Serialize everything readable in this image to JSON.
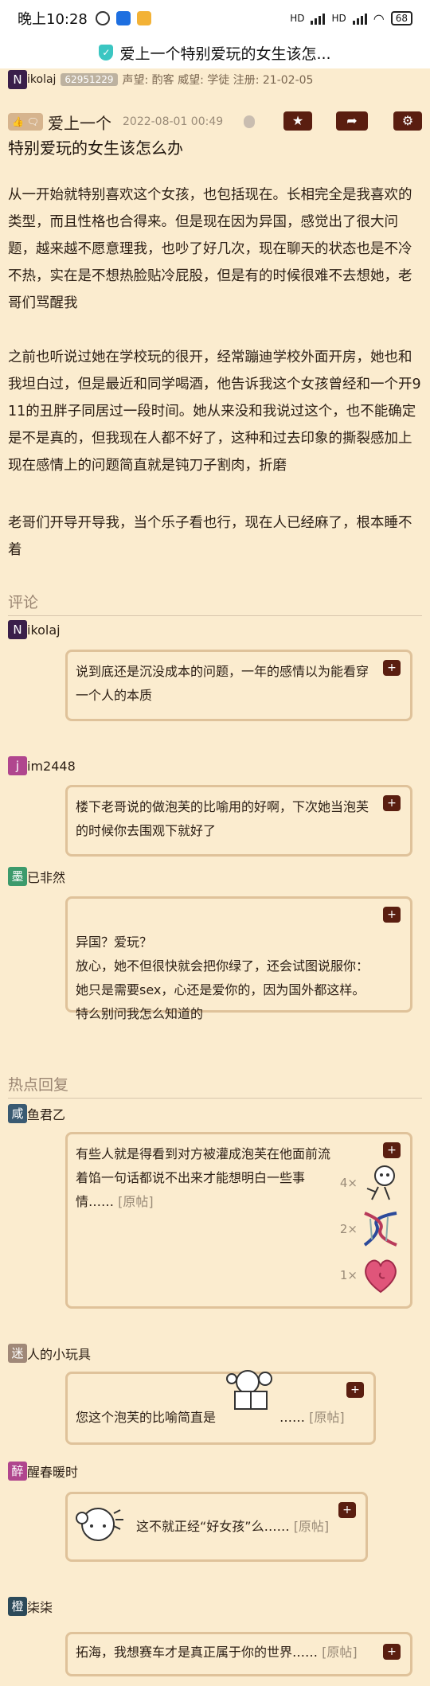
{
  "status": {
    "time": "晚上10:28",
    "signal": "HD",
    "battery": "68"
  },
  "title": "爱上一个特别爱玩的女生该怎...",
  "poster": {
    "avatar": "N",
    "name": "ikolaj",
    "uid": "62951229",
    "meta": "声望: 酌客 威望: 学徒 注册: 21-02-05"
  },
  "post": {
    "like_label": "👍 🗨",
    "title_line1": "爱上一个",
    "date": "2022-08-01 00:49",
    "title_line2": "特别爱玩的女生该怎么办",
    "paragraphs": [
      "从一开始就特别喜欢这个女孩，也包括现在。长相完全是我喜欢的类型，而且性格也合得来。但是现在因为异国，感觉出了很大问题，越来越不愿意理我，也吵了好几次，现在聊天的状态也是不冷不热，实在是不想热脸贴冷屁股，但是有的时候很难不去想她，老哥们骂醒我",
      "之前也听说过她在学校玩的很开，经常蹦迪学校外面开房，她也和我坦白过，但是最近和同学喝酒，他告诉我这个女孩曾经和一个开911的丑胖子同居过一段时间。她从来没和我说过这个，也不能确定是不是真的，但我现在人都不好了，这种和过去印象的撕裂感加上现在感情上的问题简直就是钝刀子割肉，折磨",
      "老哥们开导开导我，当个乐子看也行，现在人已经麻了，根本睡不着"
    ]
  },
  "actions": {
    "star": "★",
    "share": "➦",
    "settings": "⚙"
  },
  "comments_label": "评论",
  "comments": [
    {
      "avatar": "N",
      "avatar_color": "#3a1f4a",
      "name": "ikolaj",
      "text": "说到底还是沉没成本的问题，一年的感情以为能看穿一个人的本质"
    },
    {
      "avatar": "j",
      "avatar_color": "#b0468e",
      "name": "im2448",
      "text": "楼下老哥说的做泡芙的比喻用的好啊，下次她当泡芙的时候你去围观下就好了"
    },
    {
      "avatar": "墨",
      "avatar_color": "#3c9a6c",
      "name": "已非然",
      "text": "异国？爱玩？\n放心，她不但很快就会把你绿了，还会试图说服你：她只是需要sex，心还是爱你的，因为国外都这样。\n特么别问我怎么知道的"
    }
  ],
  "plus": "+",
  "hot_label": "热点回复",
  "hot": [
    {
      "avatar": "咸",
      "avatar_color": "#3a5a72",
      "name": "鱼君乙",
      "text": "有些人就是得看到对方被灌成泡芙在他面前流着馅一句话都说不出来才能想明白一些事情……",
      "orig": "[原帖]",
      "reactions": [
        {
          "count": "4×",
          "icon": "stick-figure"
        },
        {
          "count": "2×",
          "icon": "dna"
        },
        {
          "count": "1×",
          "icon": "heart"
        }
      ]
    },
    {
      "avatar": "迷",
      "avatar_color": "#a08878",
      "name": "人的小玩具",
      "text": "您这个泡芙的比喻简直是",
      "tail": "……",
      "orig": "[原帖]"
    },
    {
      "avatar": "醉",
      "avatar_color": "#b0468e",
      "name": "醒春暖时",
      "text": "这不就正经“好女孩”么……",
      "orig": "[原帖]"
    },
    {
      "avatar": "橙",
      "avatar_color": "#2c4a5a",
      "name": "柒柒",
      "text": "拓海，我想赛车才是真正属于你的世界……",
      "orig": "[原帖]"
    }
  ]
}
